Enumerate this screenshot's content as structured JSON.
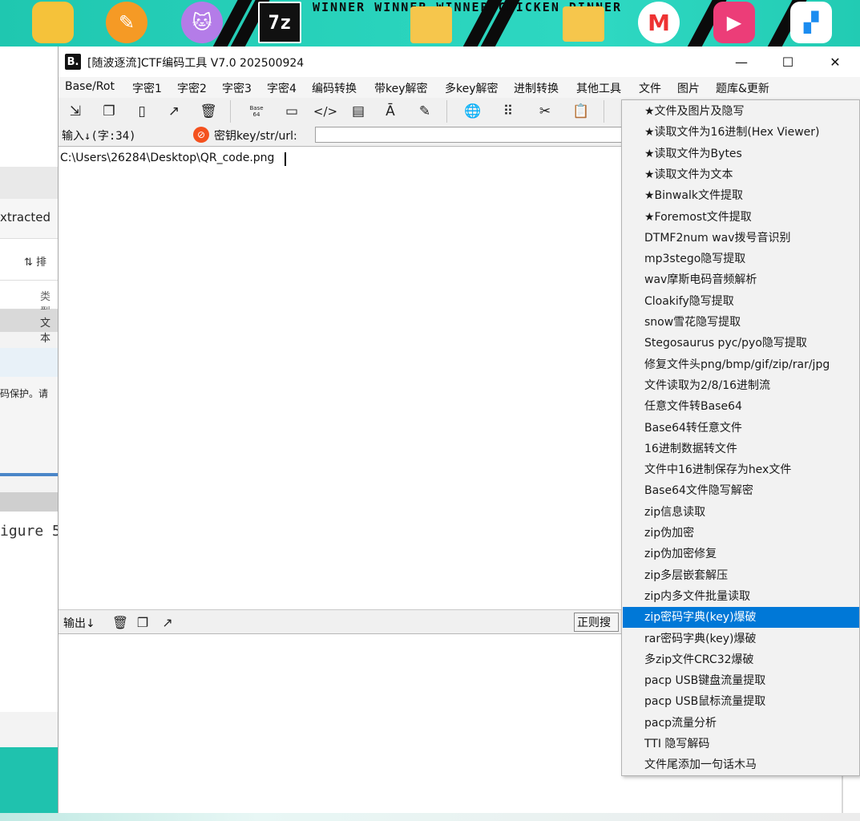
{
  "desktop": {
    "winner_text": "WINNER WINNER WINNER CHICKEN DINNER",
    "taskbar_icons": [
      "pyscript-icon",
      "pen-icon",
      "cat-icon",
      "7zip-icon",
      "folder-icon",
      "folder-icon",
      "m-app-icon",
      "play-app-icon",
      "todesk-icon"
    ],
    "sevenzip_label": "7z",
    "m_label": "M"
  },
  "background_app": {
    "texts": [
      "xtracted",
      "⇅ 排",
      "类型",
      "文本",
      "码保护。请",
      "igure 5"
    ]
  },
  "window": {
    "icon_label": "B.",
    "title": "[随波逐流]CTF编码工具 V7.0  202500924",
    "minimize": "—",
    "maximize": "☐",
    "close": "✕"
  },
  "menubar": {
    "items": [
      "Base/Rot",
      "字密1",
      "字密2",
      "字密3",
      "字密4",
      "编码转换",
      "带key解密",
      "多key解密",
      "进制转换",
      "其他工具",
      "文件",
      "图片",
      "题库&更新"
    ]
  },
  "toolbar": {
    "icons": [
      "import-icon",
      "copy-icon",
      "paste-icon",
      "share-icon",
      "trash-icon",
      "base64-icon",
      "terminal-icon",
      "code-icon",
      "table-icon",
      "font-icon",
      "edit-icon",
      "globe-icon",
      "grid-icon",
      "tools-icon",
      "clipboard-icon"
    ],
    "base64_label": "Base 64"
  },
  "input": {
    "label": "输入↓(字:34)",
    "key_label": "密钥key/str/url:",
    "key_value": "",
    "text": "C:\\Users\\26284\\Desktop\\QR_code.png"
  },
  "output": {
    "label": "输出↓",
    "regex_button": "正则搜",
    "text": ""
  },
  "dropdown": {
    "selected_index": 24,
    "items": [
      "★文件及图片及隐写",
      "★读取文件为16进制(Hex Viewer)",
      "★读取文件为Bytes",
      "★读取文件为文本",
      "★Binwalk文件提取",
      "★Foremost文件提取",
      "DTMF2num  wav拨号音识别",
      "mp3stego隐写提取",
      "wav摩斯电码音频解析",
      "Cloakify隐写提取",
      "snow雪花隐写提取",
      "Stegosaurus pyc/pyo隐写提取",
      "修复文件头png/bmp/gif/zip/rar/jpg",
      "文件读取为2/8/16进制流",
      "任意文件转Base64",
      "Base64转任意文件",
      "16进制数据转文件",
      "文件中16进制保存为hex文件",
      "Base64文件隐写解密",
      "zip信息读取",
      "zip伪加密",
      "zip伪加密修复",
      "zip多层嵌套解压",
      "zip内多文件批量读取",
      "zip密码字典(key)爆破",
      "rar密码字典(key)爆破",
      "多zip文件CRC32爆破",
      "pacp USB键盘流量提取",
      "pacp USB鼠标流量提取",
      "pacp流量分析",
      "TTI 隐写解码",
      "文件尾添加一句话木马"
    ]
  },
  "colors": {
    "selection": "#0078d7",
    "wallpaper": "#28d2bb"
  }
}
